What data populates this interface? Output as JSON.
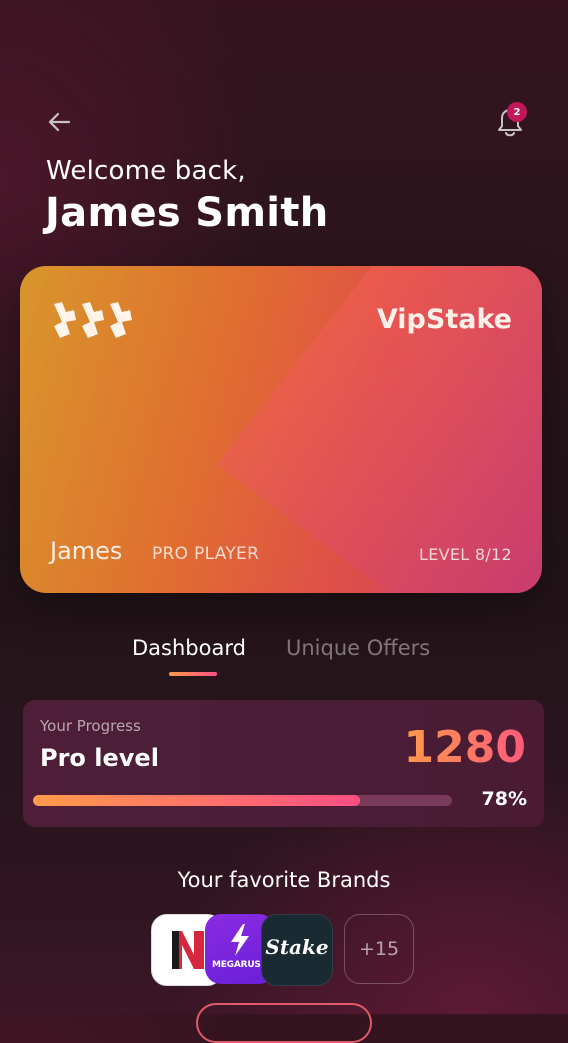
{
  "header": {
    "welcome": "Welcome back,",
    "user_name": "James Smith",
    "notification_count": "2"
  },
  "card": {
    "brand": "VipStake",
    "holder": "James",
    "tier": "PRO PLAYER",
    "level": "LEVEL 8/12"
  },
  "tabs": [
    {
      "label": "Dashboard",
      "active": true
    },
    {
      "label": "Unique Offers",
      "active": false
    }
  ],
  "progress": {
    "label": "Your Progress",
    "level_name": "Pro level",
    "points": "1280",
    "percent_label": "78%",
    "percent": 78
  },
  "brands": {
    "title": "Your favorite Brands",
    "items": [
      {
        "name": "N",
        "icon": "n-brand-logo"
      },
      {
        "name": "MEGARUSH",
        "icon": "lightning-icon"
      },
      {
        "name": "Stake",
        "icon": "stake-logo"
      }
    ],
    "more_label": "+15"
  },
  "colors": {
    "accent_start": "#ff9a4a",
    "accent_end": "#ff4f86",
    "badge": "#c2185b"
  }
}
